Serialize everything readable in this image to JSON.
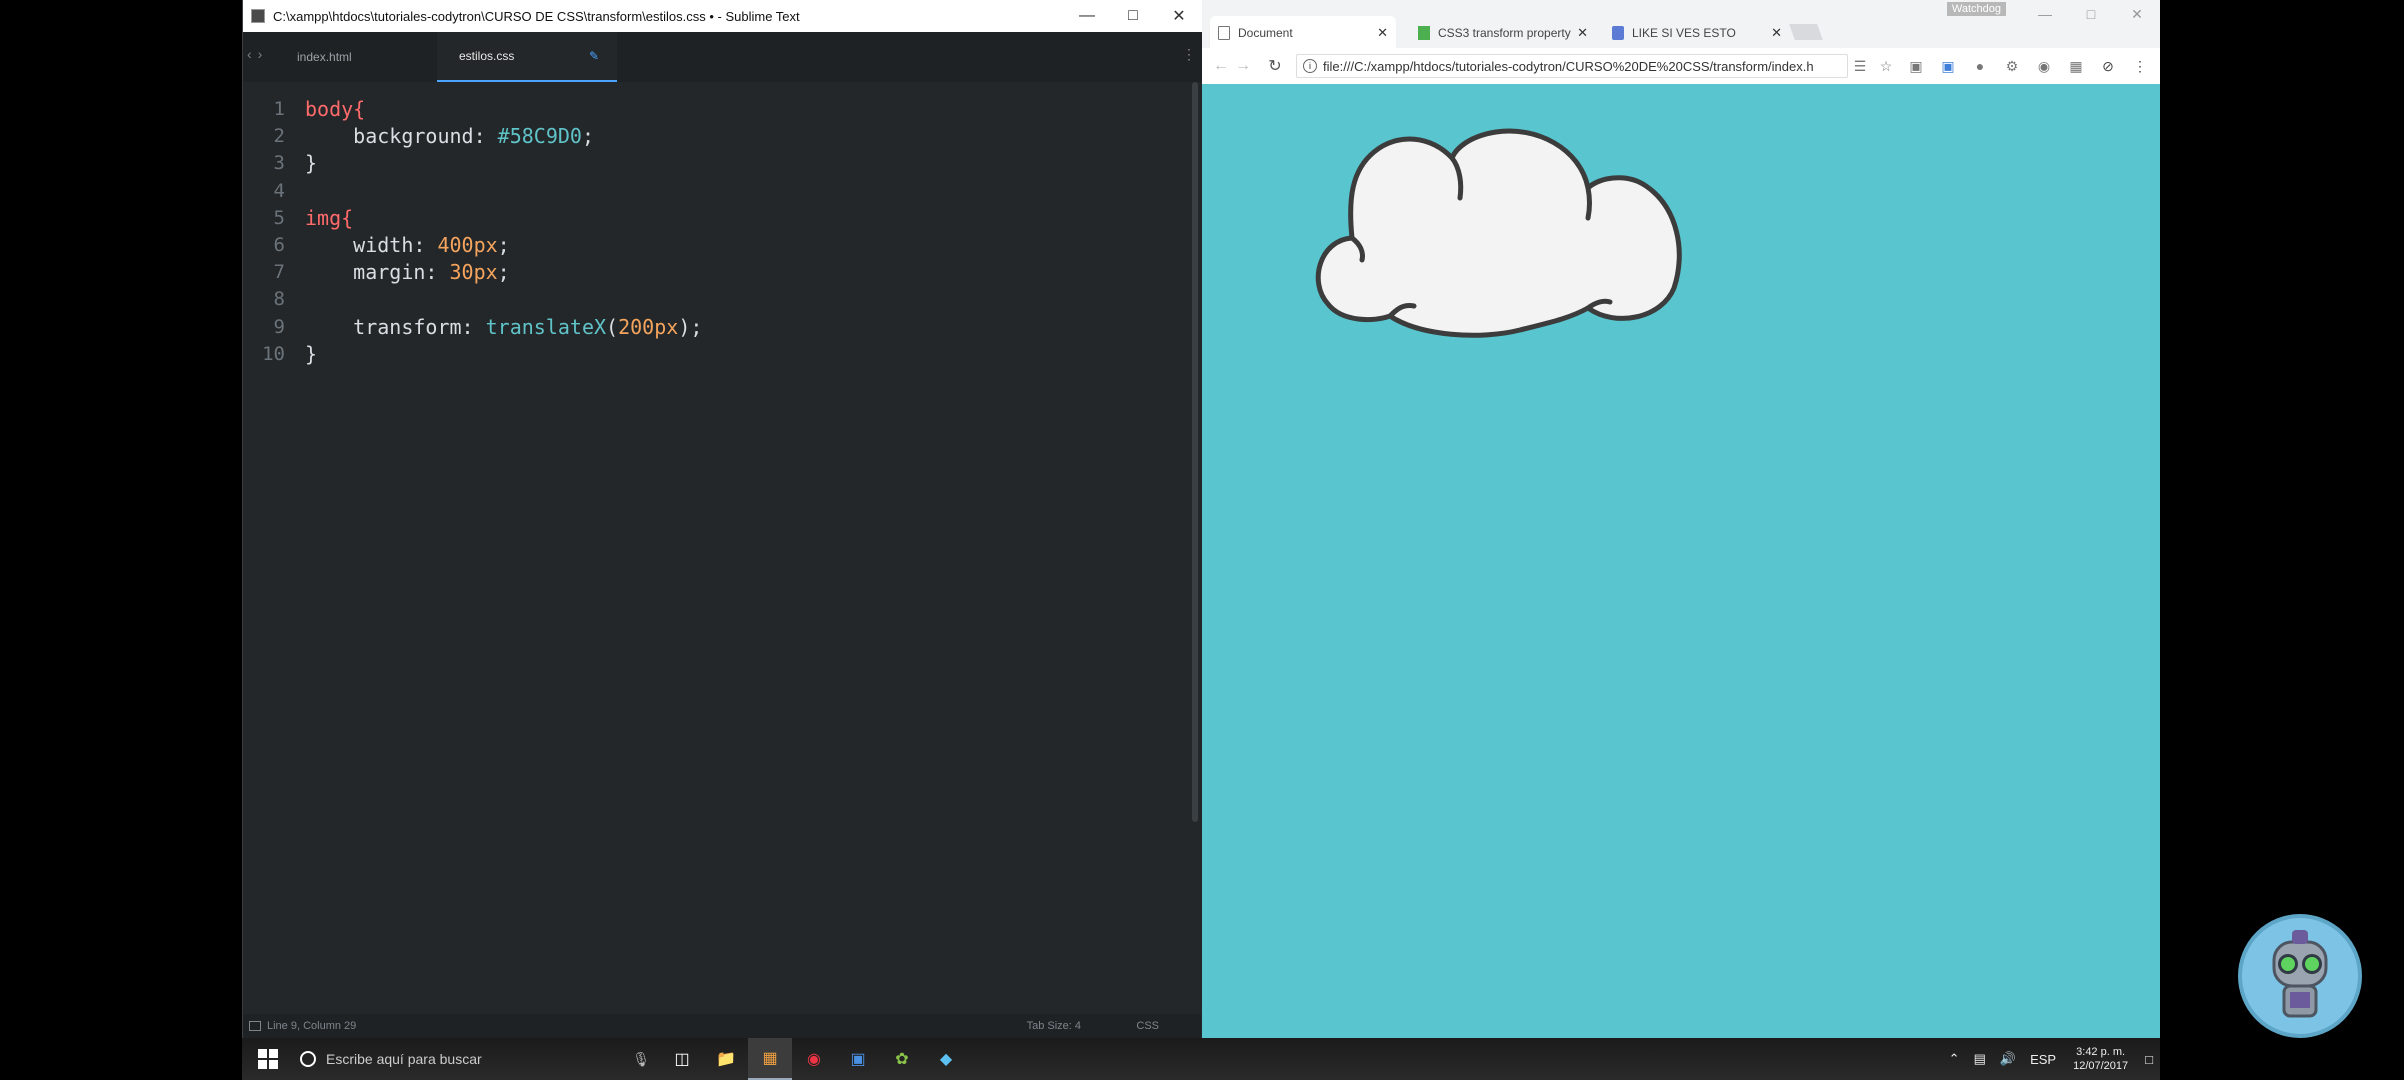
{
  "sublime": {
    "title": "C:\\xampp\\htdocs\\tutoriales-codytron\\CURSO DE CSS\\transform\\estilos.css • - Sublime Text",
    "tabs": [
      {
        "label": "index.html",
        "active": false
      },
      {
        "label": "estilos.css",
        "active": true
      }
    ],
    "lines": [
      {
        "n": "1",
        "segments": [
          {
            "t": "body",
            "c": "sel"
          },
          {
            "t": "{",
            "c": "sel"
          }
        ]
      },
      {
        "n": "2",
        "segments": [
          {
            "t": "    background: ",
            "c": "prop"
          },
          {
            "t": "#58C9D0",
            "c": "hex"
          },
          {
            "t": ";",
            "c": "punc"
          }
        ]
      },
      {
        "n": "3",
        "segments": [
          {
            "t": "}",
            "c": "punc"
          }
        ]
      },
      {
        "n": "4",
        "segments": []
      },
      {
        "n": "5",
        "segments": [
          {
            "t": "img",
            "c": "sel"
          },
          {
            "t": "{",
            "c": "sel"
          }
        ]
      },
      {
        "n": "6",
        "segments": [
          {
            "t": "    width: ",
            "c": "prop"
          },
          {
            "t": "400px",
            "c": "val"
          },
          {
            "t": ";",
            "c": "punc"
          }
        ]
      },
      {
        "n": "7",
        "segments": [
          {
            "t": "    margin: ",
            "c": "prop"
          },
          {
            "t": "30px",
            "c": "val"
          },
          {
            "t": ";",
            "c": "punc"
          }
        ]
      },
      {
        "n": "8",
        "segments": []
      },
      {
        "n": "9",
        "segments": [
          {
            "t": "    transform: ",
            "c": "prop"
          },
          {
            "t": "translateX",
            "c": "fn"
          },
          {
            "t": "(",
            "c": "punc"
          },
          {
            "t": "200px",
            "c": "val"
          },
          {
            "t": ");",
            "c": "punc"
          }
        ]
      },
      {
        "n": "10",
        "segments": [
          {
            "t": "}",
            "c": "punc"
          }
        ]
      }
    ],
    "status": {
      "position": "Line 9, Column 29",
      "tab_size": "Tab Size: 4",
      "syntax": "CSS"
    }
  },
  "chrome": {
    "profile": "Watchdog",
    "tabs": [
      {
        "label": "Document",
        "active": true,
        "favicon": "page-icon"
      },
      {
        "label": "CSS3 transform property",
        "active": false,
        "favicon": "w3schools-icon"
      },
      {
        "label": "LIKE SI VES ESTO",
        "active": false,
        "favicon": "thumbs-up-icon"
      }
    ],
    "url": "file:///C:/xampp/htdocs/tutoriales-codytron/CURSO%20DE%20CSS/transform/index.h",
    "page_background": "#58C9D0"
  },
  "taskbar": {
    "search_placeholder": "Escribe aquí para buscar",
    "language": "ESP",
    "time": "3:42 p. m.",
    "date": "12/07/2017"
  }
}
